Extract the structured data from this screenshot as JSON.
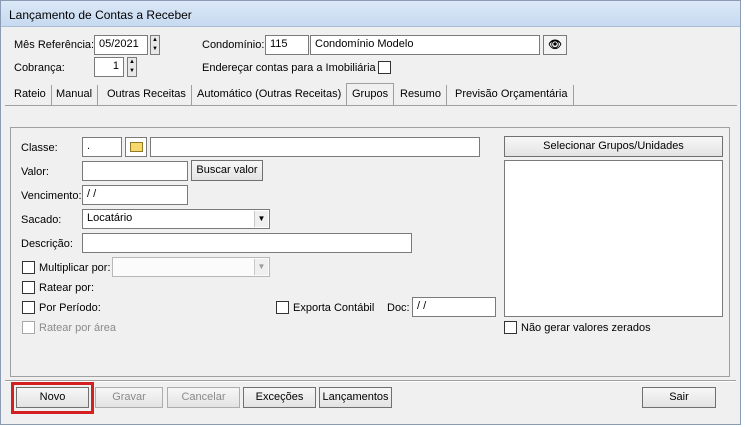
{
  "window": {
    "title": "Lançamento de Contas a Receber"
  },
  "header": {
    "mes_referencia_label": "Mês Referência:",
    "mes_referencia_value": "05/2021",
    "condominio_label": "Condomínio:",
    "condominio_code": "115",
    "condominio_name": "Condomínio Modelo",
    "cobranca_label": "Cobrança:",
    "cobranca_value": "1",
    "enderecar_label": "Endereçar contas para a Imobiliária"
  },
  "tabs": [
    {
      "label": "Rateio",
      "active": false
    },
    {
      "label": "Manual",
      "active": false
    },
    {
      "label": "Outras Receitas",
      "active": false
    },
    {
      "label": "Automático (Outras Receitas)",
      "active": false
    },
    {
      "label": "Grupos",
      "active": true
    },
    {
      "label": "Resumo",
      "active": false
    },
    {
      "label": "Previsão Orçamentária",
      "active": false
    }
  ],
  "form": {
    "classe_label": "Classe:",
    "classe_value": "   .",
    "valor_label": "Valor:",
    "buscar_valor": "Buscar valor",
    "vencimento_label": "Vencimento:",
    "vencimento_value": "  / /",
    "sacado_label": "Sacado:",
    "sacado_value": "Locatário",
    "descricao_label": "Descrição:",
    "multiplicar_label": "Multiplicar por:",
    "ratear_label": "Ratear por:",
    "periodo_label": "Por Período:",
    "ratear_area_label": "Ratear por área",
    "exporta_label": "Exporta Contábil",
    "doc_label": "Doc:",
    "doc_value": "  / /"
  },
  "grupos": {
    "selecionar_button": "Selecionar Grupos/Unidades",
    "nao_gerar_label": "Não gerar valores zerados"
  },
  "footer": {
    "novo": "Novo",
    "gravar": "Gravar",
    "cancelar": "Cancelar",
    "excecoes": "Exceções",
    "lancamentos": "Lançamentos",
    "sair": "Sair"
  },
  "colors": {
    "highlight": "#d42020",
    "title_bg": "#c7daf0"
  }
}
